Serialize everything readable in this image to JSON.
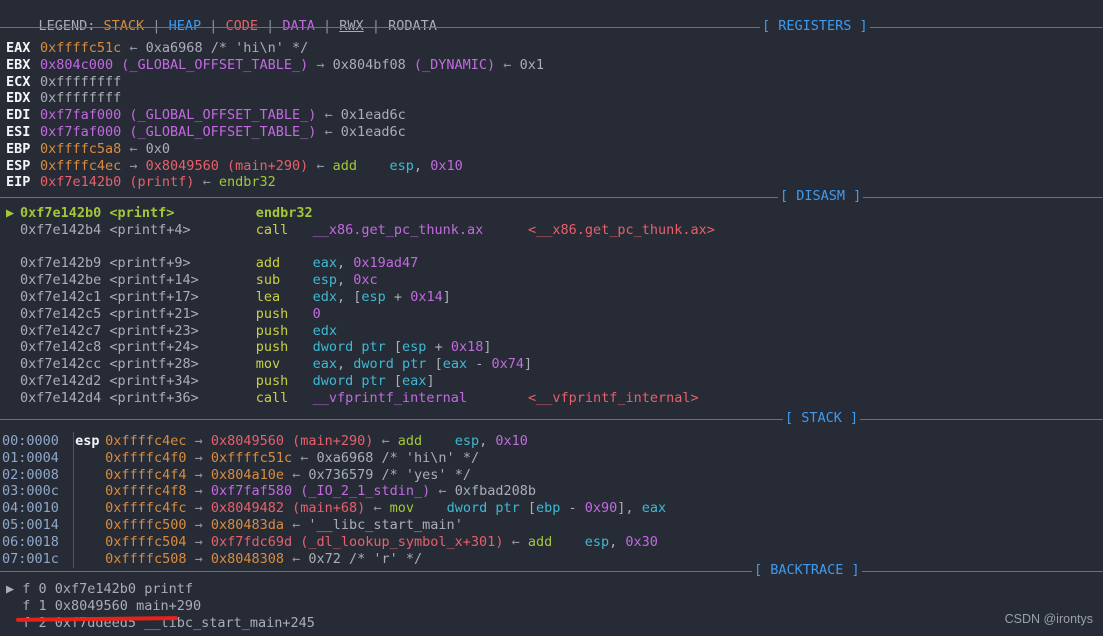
{
  "legend": {
    "prefix": "LEGEND: ",
    "items": [
      {
        "label": "STACK",
        "color": "#d98c3f",
        "underline": false
      },
      {
        "label": "HEAP",
        "color": "#3f9bf0",
        "underline": false
      },
      {
        "label": "CODE",
        "color": "#e8606a",
        "underline": false
      },
      {
        "label": "DATA",
        "color": "#c36ae0",
        "underline": false
      },
      {
        "label": "RWX",
        "color": "#a9aeb8",
        "underline": true
      },
      {
        "label": "RODATA",
        "color": "#a9aeb8",
        "underline": false
      }
    ],
    "separator": " | "
  },
  "sections": {
    "registers": "[ REGISTERS ]",
    "disasm": "[ DISASM ]",
    "stack": "[ STACK ]",
    "backtrace": "[ BACKTRACE ]"
  },
  "registers": [
    {
      "name": "EAX",
      "parts": [
        {
          "t": "0xffffc51c",
          "c": "c-orange"
        },
        {
          "t": " ← ",
          "c": "c-dim"
        },
        {
          "t": "0xa6968 /* 'hi\\n' */",
          "c": "c-gray"
        }
      ]
    },
    {
      "name": "EBX",
      "parts": [
        {
          "t": "0x804c000 ",
          "c": "c-magenta"
        },
        {
          "t": "(_GLOBAL_OFFSET_TABLE_)",
          "c": "c-magenta"
        },
        {
          "t": " → ",
          "c": "c-dim"
        },
        {
          "t": "0x804bf08 ",
          "c": "c-gray"
        },
        {
          "t": "(_DYNAMIC)",
          "c": "c-magenta"
        },
        {
          "t": " ← ",
          "c": "c-dim"
        },
        {
          "t": "0x1",
          "c": "c-gray"
        }
      ]
    },
    {
      "name": "ECX",
      "parts": [
        {
          "t": "0xffffffff",
          "c": "c-gray"
        }
      ]
    },
    {
      "name": "EDX",
      "parts": [
        {
          "t": "0xffffffff",
          "c": "c-gray"
        }
      ]
    },
    {
      "name": "EDI",
      "parts": [
        {
          "t": "0xf7faf000 ",
          "c": "c-magenta"
        },
        {
          "t": "(_GLOBAL_OFFSET_TABLE_)",
          "c": "c-magenta"
        },
        {
          "t": " ← ",
          "c": "c-dim"
        },
        {
          "t": "0x1ead6c",
          "c": "c-gray"
        }
      ]
    },
    {
      "name": "ESI",
      "parts": [
        {
          "t": "0xf7faf000 ",
          "c": "c-magenta"
        },
        {
          "t": "(_GLOBAL_OFFSET_TABLE_)",
          "c": "c-magenta"
        },
        {
          "t": " ← ",
          "c": "c-dim"
        },
        {
          "t": "0x1ead6c",
          "c": "c-gray"
        }
      ]
    },
    {
      "name": "EBP",
      "parts": [
        {
          "t": "0xffffc5a8",
          "c": "c-orange"
        },
        {
          "t": " ← ",
          "c": "c-dim"
        },
        {
          "t": "0x0",
          "c": "c-gray"
        }
      ]
    },
    {
      "name": "ESP",
      "parts": [
        {
          "t": "0xffffc4ec",
          "c": "c-orange"
        },
        {
          "t": " → ",
          "c": "c-dim"
        },
        {
          "t": "0x8049560 ",
          "c": "c-red"
        },
        {
          "t": "(main+290)",
          "c": "c-red"
        },
        {
          "t": " ← ",
          "c": "c-dim"
        },
        {
          "t": "add",
          "c": "c-green"
        },
        {
          "t": "    ",
          "c": "c-gray"
        },
        {
          "t": "esp",
          "c": "c-cyan"
        },
        {
          "t": ", ",
          "c": "c-gray"
        },
        {
          "t": "0x10",
          "c": "c-magenta"
        }
      ]
    },
    {
      "name": "EIP",
      "parts": [
        {
          "t": "0xf7e142b0 ",
          "c": "c-red"
        },
        {
          "t": "(printf)",
          "c": "c-red"
        },
        {
          "t": " ← ",
          "c": "c-dim"
        },
        {
          "t": "endbr32",
          "c": "c-green"
        }
      ]
    }
  ],
  "disasm": [
    {
      "current": true,
      "addr": "0xf7e142b0",
      "sym": "<printf>",
      "mnemonic": "endbr32",
      "operands": [],
      "comment": ""
    },
    {
      "current": false,
      "addr": "0xf7e142b4",
      "sym": "<printf+4>",
      "mnemonic": "call",
      "operands": [
        {
          "t": "__x86.get_pc_thunk.ax",
          "c": "c-magenta"
        }
      ],
      "comment": "<__x86.get_pc_thunk.ax>"
    },
    {
      "blank": true
    },
    {
      "current": false,
      "addr": "0xf7e142b9",
      "sym": "<printf+9>",
      "mnemonic": "add",
      "operands": [
        {
          "t": "eax",
          "c": "c-cyan"
        },
        {
          "t": ", ",
          "c": "c-gray"
        },
        {
          "t": "0x19ad47",
          "c": "c-magenta"
        }
      ],
      "comment": ""
    },
    {
      "current": false,
      "addr": "0xf7e142be",
      "sym": "<printf+14>",
      "mnemonic": "sub",
      "operands": [
        {
          "t": "esp",
          "c": "c-cyan"
        },
        {
          "t": ", ",
          "c": "c-gray"
        },
        {
          "t": "0xc",
          "c": "c-magenta"
        }
      ],
      "comment": ""
    },
    {
      "current": false,
      "addr": "0xf7e142c1",
      "sym": "<printf+17>",
      "mnemonic": "lea",
      "operands": [
        {
          "t": "edx",
          "c": "c-cyan"
        },
        {
          "t": ", [",
          "c": "c-gray"
        },
        {
          "t": "esp",
          "c": "c-cyan"
        },
        {
          "t": " + ",
          "c": "c-gray"
        },
        {
          "t": "0x14",
          "c": "c-magenta"
        },
        {
          "t": "]",
          "c": "c-gray"
        }
      ],
      "comment": ""
    },
    {
      "current": false,
      "addr": "0xf7e142c5",
      "sym": "<printf+21>",
      "mnemonic": "push",
      "operands": [
        {
          "t": "0",
          "c": "c-magenta"
        }
      ],
      "comment": ""
    },
    {
      "current": false,
      "addr": "0xf7e142c7",
      "sym": "<printf+23>",
      "mnemonic": "push",
      "operands": [
        {
          "t": "edx",
          "c": "c-cyan"
        }
      ],
      "comment": ""
    },
    {
      "current": false,
      "addr": "0xf7e142c8",
      "sym": "<printf+24>",
      "mnemonic": "push",
      "operands": [
        {
          "t": "dword ptr ",
          "c": "c-cyan"
        },
        {
          "t": "[",
          "c": "c-gray"
        },
        {
          "t": "esp",
          "c": "c-cyan"
        },
        {
          "t": " + ",
          "c": "c-gray"
        },
        {
          "t": "0x18",
          "c": "c-magenta"
        },
        {
          "t": "]",
          "c": "c-gray"
        }
      ],
      "comment": ""
    },
    {
      "current": false,
      "addr": "0xf7e142cc",
      "sym": "<printf+28>",
      "mnemonic": "mov",
      "operands": [
        {
          "t": "eax",
          "c": "c-cyan"
        },
        {
          "t": ", ",
          "c": "c-gray"
        },
        {
          "t": "dword ptr ",
          "c": "c-cyan"
        },
        {
          "t": "[",
          "c": "c-gray"
        },
        {
          "t": "eax",
          "c": "c-cyan"
        },
        {
          "t": " - ",
          "c": "c-gray"
        },
        {
          "t": "0x74",
          "c": "c-magenta"
        },
        {
          "t": "]",
          "c": "c-gray"
        }
      ],
      "comment": ""
    },
    {
      "current": false,
      "addr": "0xf7e142d2",
      "sym": "<printf+34>",
      "mnemonic": "push",
      "operands": [
        {
          "t": "dword ptr ",
          "c": "c-cyan"
        },
        {
          "t": "[",
          "c": "c-gray"
        },
        {
          "t": "eax",
          "c": "c-cyan"
        },
        {
          "t": "]",
          "c": "c-gray"
        }
      ],
      "comment": ""
    },
    {
      "current": false,
      "addr": "0xf7e142d4",
      "sym": "<printf+36>",
      "mnemonic": "call",
      "operands": [
        {
          "t": "__vfprintf_internal",
          "c": "c-magenta"
        }
      ],
      "comment": "<__vfprintf_internal>"
    }
  ],
  "stack": [
    {
      "off": "00:0000",
      "reg": "esp",
      "parts": [
        {
          "t": "0xffffc4ec",
          "c": "c-orange"
        },
        {
          "t": " → ",
          "c": "c-dim"
        },
        {
          "t": "0x8049560 ",
          "c": "c-red"
        },
        {
          "t": "(main+290)",
          "c": "c-red"
        },
        {
          "t": " ← ",
          "c": "c-dim"
        },
        {
          "t": "add",
          "c": "c-green"
        },
        {
          "t": "    ",
          "c": "c-gray"
        },
        {
          "t": "esp",
          "c": "c-cyan"
        },
        {
          "t": ", ",
          "c": "c-gray"
        },
        {
          "t": "0x10",
          "c": "c-magenta"
        }
      ]
    },
    {
      "off": "01:0004",
      "reg": "",
      "parts": [
        {
          "t": "0xffffc4f0",
          "c": "c-orange"
        },
        {
          "t": " → ",
          "c": "c-dim"
        },
        {
          "t": "0xffffc51c",
          "c": "c-orange"
        },
        {
          "t": " ← ",
          "c": "c-dim"
        },
        {
          "t": "0xa6968 /* 'hi\\n' */",
          "c": "c-gray"
        }
      ]
    },
    {
      "off": "02:0008",
      "reg": "",
      "parts": [
        {
          "t": "0xffffc4f4",
          "c": "c-orange"
        },
        {
          "t": " → ",
          "c": "c-dim"
        },
        {
          "t": "0x804a10e",
          "c": "c-orange"
        },
        {
          "t": " ← ",
          "c": "c-dim"
        },
        {
          "t": "0x736579 /* 'yes' */",
          "c": "c-gray"
        }
      ]
    },
    {
      "off": "03:000c",
      "reg": "",
      "parts": [
        {
          "t": "0xffffc4f8",
          "c": "c-orange"
        },
        {
          "t": " → ",
          "c": "c-dim"
        },
        {
          "t": "0xf7faf580 ",
          "c": "c-magenta"
        },
        {
          "t": "(_IO_2_1_stdin_)",
          "c": "c-magenta"
        },
        {
          "t": " ← ",
          "c": "c-dim"
        },
        {
          "t": "0xfbad208b",
          "c": "c-gray"
        }
      ]
    },
    {
      "off": "04:0010",
      "reg": "",
      "parts": [
        {
          "t": "0xffffc4fc",
          "c": "c-orange"
        },
        {
          "t": " → ",
          "c": "c-dim"
        },
        {
          "t": "0x8049482 ",
          "c": "c-red"
        },
        {
          "t": "(main+68)",
          "c": "c-red"
        },
        {
          "t": " ← ",
          "c": "c-dim"
        },
        {
          "t": "mov",
          "c": "c-green"
        },
        {
          "t": "    ",
          "c": "c-gray"
        },
        {
          "t": "dword ptr ",
          "c": "c-cyan"
        },
        {
          "t": "[",
          "c": "c-gray"
        },
        {
          "t": "ebp",
          "c": "c-cyan"
        },
        {
          "t": " - ",
          "c": "c-gray"
        },
        {
          "t": "0x90",
          "c": "c-magenta"
        },
        {
          "t": "], ",
          "c": "c-gray"
        },
        {
          "t": "eax",
          "c": "c-cyan"
        }
      ]
    },
    {
      "off": "05:0014",
      "reg": "",
      "parts": [
        {
          "t": "0xffffc500",
          "c": "c-orange"
        },
        {
          "t": " → ",
          "c": "c-dim"
        },
        {
          "t": "0x80483da",
          "c": "c-orange"
        },
        {
          "t": " ← ",
          "c": "c-dim"
        },
        {
          "t": "'__libc_start_main'",
          "c": "c-gray"
        }
      ]
    },
    {
      "off": "06:0018",
      "reg": "",
      "parts": [
        {
          "t": "0xffffc504",
          "c": "c-orange"
        },
        {
          "t": " → ",
          "c": "c-dim"
        },
        {
          "t": "0xf7fdc69d ",
          "c": "c-red"
        },
        {
          "t": "(_dl_lookup_symbol_x+301)",
          "c": "c-red"
        },
        {
          "t": " ← ",
          "c": "c-dim"
        },
        {
          "t": "add",
          "c": "c-green"
        },
        {
          "t": "    ",
          "c": "c-gray"
        },
        {
          "t": "esp",
          "c": "c-cyan"
        },
        {
          "t": ", ",
          "c": "c-gray"
        },
        {
          "t": "0x30",
          "c": "c-magenta"
        }
      ]
    },
    {
      "off": "07:001c",
      "reg": "",
      "parts": [
        {
          "t": "0xffffc508",
          "c": "c-orange"
        },
        {
          "t": " → ",
          "c": "c-dim"
        },
        {
          "t": "0x8048308",
          "c": "c-orange"
        },
        {
          "t": " ← ",
          "c": "c-dim"
        },
        {
          "t": "0x72 /* 'r' */",
          "c": "c-gray"
        }
      ]
    }
  ],
  "backtrace": [
    {
      "marker": "▶",
      "frame": "f 0",
      "addr": "0xf7e142b0",
      "symbol": "printf"
    },
    {
      "marker": "",
      "frame": "f 1",
      "addr": "0x8049560",
      "symbol": "main+290"
    },
    {
      "marker": "",
      "frame": "f 2",
      "addr": "0xf7ddeed5",
      "symbol": "__libc_start_main+245"
    }
  ],
  "annotation": {
    "color": "#e8211b",
    "name": "red-underline-highlight"
  },
  "watermark": "CSDN @irontys"
}
